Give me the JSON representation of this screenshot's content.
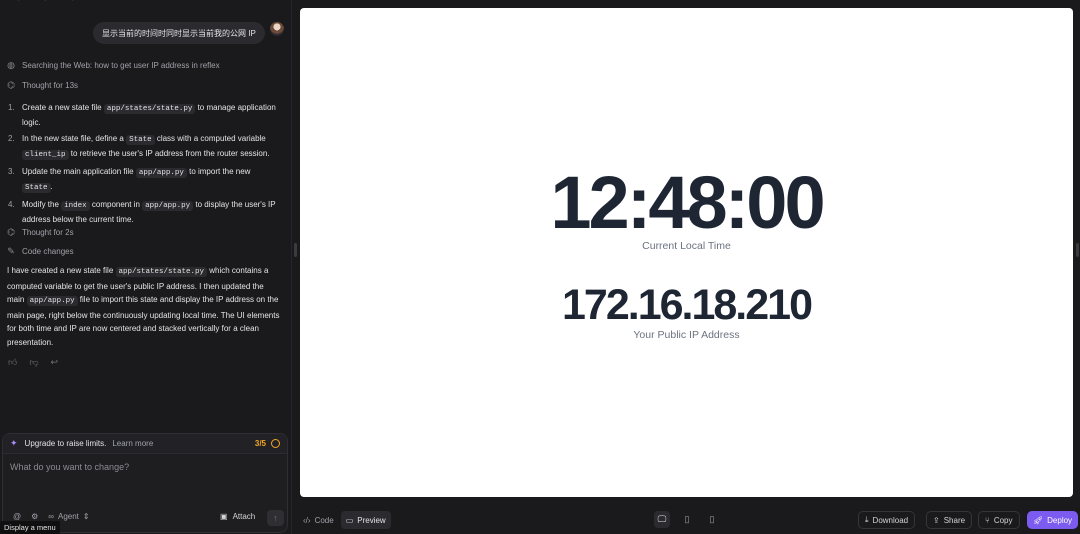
{
  "chat": {
    "user_message": "显示当前的时间时同时显示当前我的公网 IP",
    "search_step": "Searching the Web: how to get user IP address in reflex",
    "thought_1": "Thought for 13s",
    "plan": [
      {
        "num": "1.",
        "parts": [
          "Create a new state file ",
          "app/states/state.py",
          " to manage application logic."
        ]
      },
      {
        "num": "2.",
        "parts": [
          "In the new state file, define a ",
          "State",
          " class with a computed variable ",
          "client_ip",
          " to retrieve the user's IP address from the router session."
        ]
      },
      {
        "num": "3.",
        "parts": [
          "Update the main application file ",
          "app/app.py",
          " to import the new ",
          "State",
          "."
        ]
      },
      {
        "num": "4.",
        "parts": [
          "Modify the ",
          "index",
          " component in ",
          "app/app.py",
          " to display the user's IP address below the current time."
        ]
      }
    ],
    "thought_2": "Thought for 2s",
    "code_changes": "Code changes",
    "summary_parts": [
      "I have created a new state file ",
      "app/states/state.py",
      " which contains a computed variable to get the user's public IP address. I then updated the main ",
      "app/app.py",
      " file to import this state and display the IP address on the main page, right below the continuously updating local time. The UI elements for both time and IP are now centered and stacked vertically for a clean presentation."
    ]
  },
  "composer": {
    "upgrade_text": "Upgrade to raise limits.",
    "learn_more": "Learn more",
    "quota": "3/5",
    "placeholder": "What do you want to change?",
    "agent_label": "Agent",
    "attach_label": "Attach",
    "tooltip": "Display a menu"
  },
  "preview": {
    "time": "12:48:00",
    "time_label": "Current Local Time",
    "ip": "172.16.18.210",
    "ip_label": "Your Public IP Address"
  },
  "toolbar": {
    "code_tab": "Code",
    "preview_tab": "Preview",
    "download": "Download",
    "share": "Share",
    "copy": "Copy",
    "deploy": "Deploy"
  },
  "colors": {
    "accent": "#7c5cf0",
    "quota": "#f5a524",
    "preview_text": "#1e2533"
  }
}
